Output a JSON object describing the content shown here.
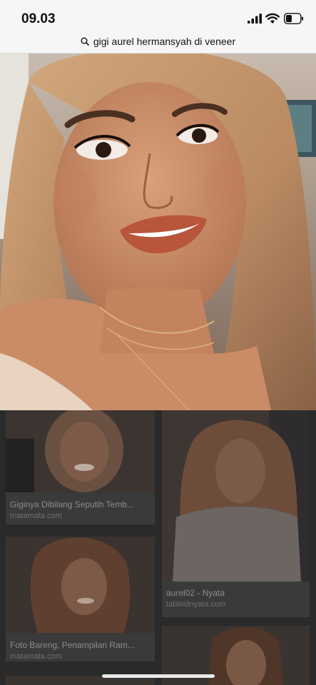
{
  "status": {
    "time": "09.03"
  },
  "search": {
    "query": "gigi aurel hermansyah di veneer",
    "icon": "search-icon"
  },
  "results": [
    {
      "title": "Giginya Dibilang Seputih Temb...",
      "source": "matamata.com"
    },
    {
      "title": "aurel02 - Nyata",
      "source": "tabloidnyata.com"
    },
    {
      "title": "Foto Bareng, Penampilan Ram...",
      "source": "matamata.com"
    }
  ],
  "colors": {
    "status_bg": "#f6f6f6",
    "overlay_dark": "#2a2a2a"
  }
}
